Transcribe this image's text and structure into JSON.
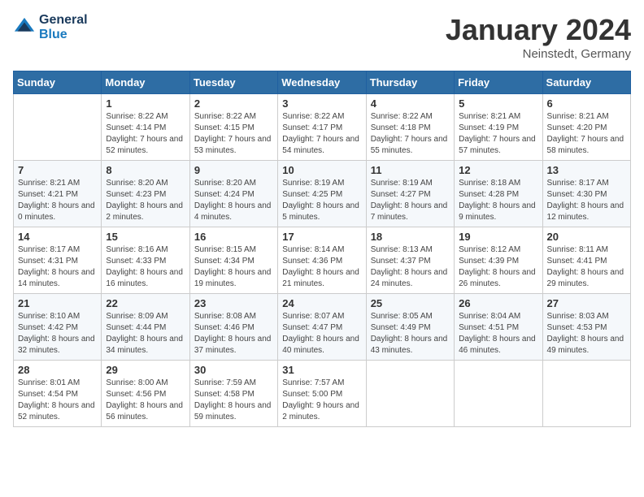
{
  "header": {
    "logo_line1": "General",
    "logo_line2": "Blue",
    "month_title": "January 2024",
    "location": "Neinstedt, Germany"
  },
  "days_of_week": [
    "Sunday",
    "Monday",
    "Tuesday",
    "Wednesday",
    "Thursday",
    "Friday",
    "Saturday"
  ],
  "weeks": [
    [
      {
        "num": "",
        "sunrise": "",
        "sunset": "",
        "daylight": ""
      },
      {
        "num": "1",
        "sunrise": "Sunrise: 8:22 AM",
        "sunset": "Sunset: 4:14 PM",
        "daylight": "Daylight: 7 hours and 52 minutes."
      },
      {
        "num": "2",
        "sunrise": "Sunrise: 8:22 AM",
        "sunset": "Sunset: 4:15 PM",
        "daylight": "Daylight: 7 hours and 53 minutes."
      },
      {
        "num": "3",
        "sunrise": "Sunrise: 8:22 AM",
        "sunset": "Sunset: 4:17 PM",
        "daylight": "Daylight: 7 hours and 54 minutes."
      },
      {
        "num": "4",
        "sunrise": "Sunrise: 8:22 AM",
        "sunset": "Sunset: 4:18 PM",
        "daylight": "Daylight: 7 hours and 55 minutes."
      },
      {
        "num": "5",
        "sunrise": "Sunrise: 8:21 AM",
        "sunset": "Sunset: 4:19 PM",
        "daylight": "Daylight: 7 hours and 57 minutes."
      },
      {
        "num": "6",
        "sunrise": "Sunrise: 8:21 AM",
        "sunset": "Sunset: 4:20 PM",
        "daylight": "Daylight: 7 hours and 58 minutes."
      }
    ],
    [
      {
        "num": "7",
        "sunrise": "Sunrise: 8:21 AM",
        "sunset": "Sunset: 4:21 PM",
        "daylight": "Daylight: 8 hours and 0 minutes."
      },
      {
        "num": "8",
        "sunrise": "Sunrise: 8:20 AM",
        "sunset": "Sunset: 4:23 PM",
        "daylight": "Daylight: 8 hours and 2 minutes."
      },
      {
        "num": "9",
        "sunrise": "Sunrise: 8:20 AM",
        "sunset": "Sunset: 4:24 PM",
        "daylight": "Daylight: 8 hours and 4 minutes."
      },
      {
        "num": "10",
        "sunrise": "Sunrise: 8:19 AM",
        "sunset": "Sunset: 4:25 PM",
        "daylight": "Daylight: 8 hours and 5 minutes."
      },
      {
        "num": "11",
        "sunrise": "Sunrise: 8:19 AM",
        "sunset": "Sunset: 4:27 PM",
        "daylight": "Daylight: 8 hours and 7 minutes."
      },
      {
        "num": "12",
        "sunrise": "Sunrise: 8:18 AM",
        "sunset": "Sunset: 4:28 PM",
        "daylight": "Daylight: 8 hours and 9 minutes."
      },
      {
        "num": "13",
        "sunrise": "Sunrise: 8:17 AM",
        "sunset": "Sunset: 4:30 PM",
        "daylight": "Daylight: 8 hours and 12 minutes."
      }
    ],
    [
      {
        "num": "14",
        "sunrise": "Sunrise: 8:17 AM",
        "sunset": "Sunset: 4:31 PM",
        "daylight": "Daylight: 8 hours and 14 minutes."
      },
      {
        "num": "15",
        "sunrise": "Sunrise: 8:16 AM",
        "sunset": "Sunset: 4:33 PM",
        "daylight": "Daylight: 8 hours and 16 minutes."
      },
      {
        "num": "16",
        "sunrise": "Sunrise: 8:15 AM",
        "sunset": "Sunset: 4:34 PM",
        "daylight": "Daylight: 8 hours and 19 minutes."
      },
      {
        "num": "17",
        "sunrise": "Sunrise: 8:14 AM",
        "sunset": "Sunset: 4:36 PM",
        "daylight": "Daylight: 8 hours and 21 minutes."
      },
      {
        "num": "18",
        "sunrise": "Sunrise: 8:13 AM",
        "sunset": "Sunset: 4:37 PM",
        "daylight": "Daylight: 8 hours and 24 minutes."
      },
      {
        "num": "19",
        "sunrise": "Sunrise: 8:12 AM",
        "sunset": "Sunset: 4:39 PM",
        "daylight": "Daylight: 8 hours and 26 minutes."
      },
      {
        "num": "20",
        "sunrise": "Sunrise: 8:11 AM",
        "sunset": "Sunset: 4:41 PM",
        "daylight": "Daylight: 8 hours and 29 minutes."
      }
    ],
    [
      {
        "num": "21",
        "sunrise": "Sunrise: 8:10 AM",
        "sunset": "Sunset: 4:42 PM",
        "daylight": "Daylight: 8 hours and 32 minutes."
      },
      {
        "num": "22",
        "sunrise": "Sunrise: 8:09 AM",
        "sunset": "Sunset: 4:44 PM",
        "daylight": "Daylight: 8 hours and 34 minutes."
      },
      {
        "num": "23",
        "sunrise": "Sunrise: 8:08 AM",
        "sunset": "Sunset: 4:46 PM",
        "daylight": "Daylight: 8 hours and 37 minutes."
      },
      {
        "num": "24",
        "sunrise": "Sunrise: 8:07 AM",
        "sunset": "Sunset: 4:47 PM",
        "daylight": "Daylight: 8 hours and 40 minutes."
      },
      {
        "num": "25",
        "sunrise": "Sunrise: 8:05 AM",
        "sunset": "Sunset: 4:49 PM",
        "daylight": "Daylight: 8 hours and 43 minutes."
      },
      {
        "num": "26",
        "sunrise": "Sunrise: 8:04 AM",
        "sunset": "Sunset: 4:51 PM",
        "daylight": "Daylight: 8 hours and 46 minutes."
      },
      {
        "num": "27",
        "sunrise": "Sunrise: 8:03 AM",
        "sunset": "Sunset: 4:53 PM",
        "daylight": "Daylight: 8 hours and 49 minutes."
      }
    ],
    [
      {
        "num": "28",
        "sunrise": "Sunrise: 8:01 AM",
        "sunset": "Sunset: 4:54 PM",
        "daylight": "Daylight: 8 hours and 52 minutes."
      },
      {
        "num": "29",
        "sunrise": "Sunrise: 8:00 AM",
        "sunset": "Sunset: 4:56 PM",
        "daylight": "Daylight: 8 hours and 56 minutes."
      },
      {
        "num": "30",
        "sunrise": "Sunrise: 7:59 AM",
        "sunset": "Sunset: 4:58 PM",
        "daylight": "Daylight: 8 hours and 59 minutes."
      },
      {
        "num": "31",
        "sunrise": "Sunrise: 7:57 AM",
        "sunset": "Sunset: 5:00 PM",
        "daylight": "Daylight: 9 hours and 2 minutes."
      },
      {
        "num": "",
        "sunrise": "",
        "sunset": "",
        "daylight": ""
      },
      {
        "num": "",
        "sunrise": "",
        "sunset": "",
        "daylight": ""
      },
      {
        "num": "",
        "sunrise": "",
        "sunset": "",
        "daylight": ""
      }
    ]
  ]
}
